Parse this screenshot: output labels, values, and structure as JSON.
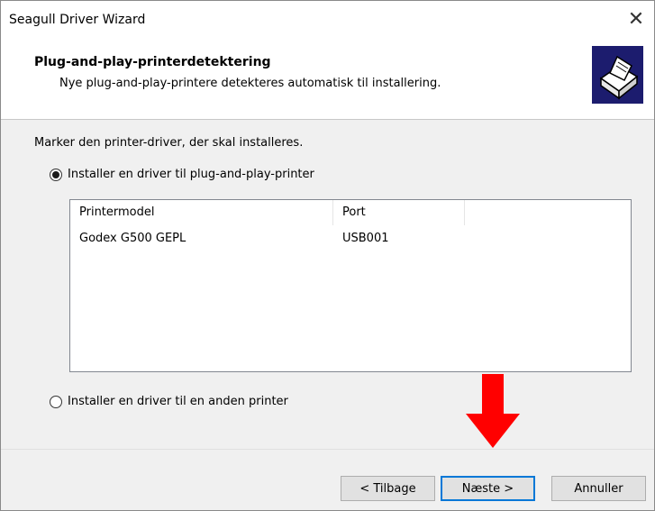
{
  "window": {
    "title": "Seagull Driver Wizard",
    "close_glyph": "✕"
  },
  "header": {
    "title": "Plug-and-play-printerdetektering",
    "subtitle": "Nye plug-and-play-printere detekteres automatisk til installering.",
    "icon": "printer-icon"
  },
  "body": {
    "instruction": "Marker den printer-driver, der skal installeres.",
    "option_pnp": {
      "label": "Installer en driver til plug-and-play-printer",
      "checked": true
    },
    "option_other": {
      "label": "Installer en driver til en anden printer",
      "checked": false
    },
    "list": {
      "columns": [
        "Printermodel",
        "Port"
      ],
      "rows": [
        {
          "model": "Godex G500 GEPL",
          "port": "USB001"
        }
      ]
    }
  },
  "annotation": {
    "arrow_color": "#ff0000",
    "icon": "arrow-down-icon"
  },
  "footer": {
    "back_label": "< Tilbage",
    "next_label": "Næste >",
    "cancel_label": "Annuller"
  },
  "colors": {
    "icon_bg": "#1c1c6e",
    "focus_border": "#0078d7"
  }
}
